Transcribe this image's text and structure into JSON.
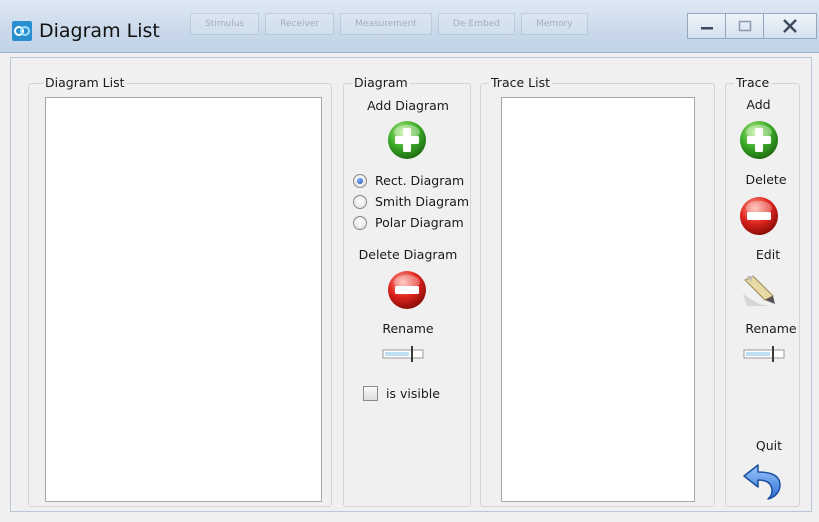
{
  "window": {
    "title": "Diagram List",
    "background_tabs": [
      "Stimulus",
      "Receiver",
      "Measurement",
      "De-Embed",
      "Memory"
    ]
  },
  "diagram_list_group": {
    "title": "Diagram List"
  },
  "diagram_group": {
    "title": "Diagram",
    "add_label": "Add Diagram",
    "diagram_types": [
      {
        "label": "Rect. Diagram",
        "checked": true
      },
      {
        "label": "Smith Diagram",
        "checked": false
      },
      {
        "label": "Polar Diagram",
        "checked": false
      }
    ],
    "delete_label": "Delete Diagram",
    "rename_label": "Rename",
    "visible_label": "is visible",
    "visible_checked": false
  },
  "trace_list_group": {
    "title": "Trace List"
  },
  "trace_group": {
    "title": "Trace",
    "add_label": "Add",
    "delete_label": "Delete",
    "edit_label": "Edit",
    "rename_label": "Rename",
    "quit_label": "Quit"
  },
  "colors": {
    "add_green": "#3fae2a",
    "delete_red": "#e0261f",
    "quit_blue": "#2f6fd0"
  }
}
